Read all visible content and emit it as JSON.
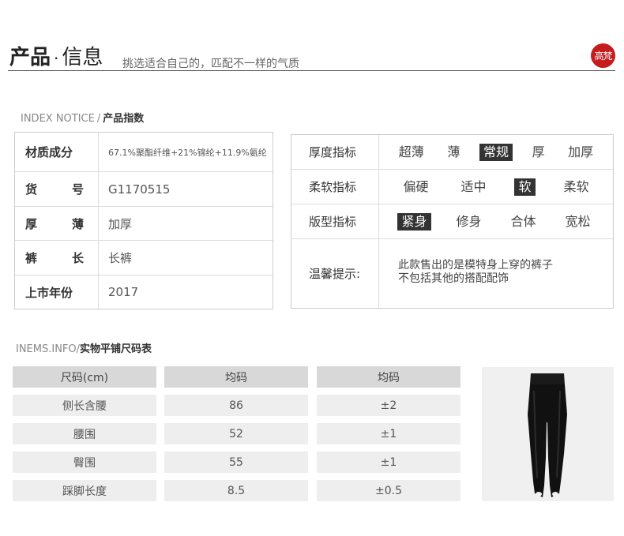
{
  "header": {
    "title_main": "产品",
    "title_dot": "·",
    "title_sub": "信息",
    "subtitle": "挑选适合自己的，匹配不一样的气质",
    "seal_text": "高梵"
  },
  "index_notice": {
    "en": "INDEX NOTICE",
    "sep": "/",
    "zh": "产品指数"
  },
  "info": [
    {
      "key": "材质成分",
      "value": "67.1%聚酯纤维+21%锦纶+11.9%氨纶"
    },
    {
      "key_a": "货",
      "key_b": "号",
      "value": "G1170515"
    },
    {
      "key_a": "厚",
      "key_b": "薄",
      "value": "加厚"
    },
    {
      "key_a": "裤",
      "key_b": "长",
      "value": "长裤"
    },
    {
      "key": "上市年份",
      "value": "2017"
    }
  ],
  "indices": {
    "thickness": {
      "label": "厚度指标",
      "options": [
        "超薄",
        "薄",
        "常规",
        "厚",
        "加厚"
      ],
      "selected": "常规"
    },
    "softness": {
      "label": "柔软指标",
      "options": [
        "偏硬",
        "适中",
        "软",
        "柔软"
      ],
      "selected": "软"
    },
    "fit": {
      "label": "版型指标",
      "options": [
        "紧身",
        "修身",
        "合体",
        "宽松"
      ],
      "selected": "紧身"
    },
    "tip": {
      "label": "温馨提示:",
      "line1": "此款售出的是模特身上穿的裤子",
      "line2": "不包括其他的搭配配饰"
    }
  },
  "size_section": {
    "en": "INEMS.INFO",
    "sep": "/",
    "zh": "实物平铺尺码表"
  },
  "size_table": {
    "headers": [
      "尺码(cm)",
      "均码",
      "均码"
    ],
    "rows": [
      [
        "侧长含腰",
        "86",
        "±2"
      ],
      [
        "腰围",
        "52",
        "±1"
      ],
      [
        "臀围",
        "55",
        "±1"
      ],
      [
        "踩脚长度",
        "8.5",
        "±0.5"
      ]
    ]
  },
  "colors": {
    "accent_red": "#c51d1d",
    "selected_bg": "#333333"
  },
  "icons": {
    "product": "black-stirrup-leggings-image"
  }
}
